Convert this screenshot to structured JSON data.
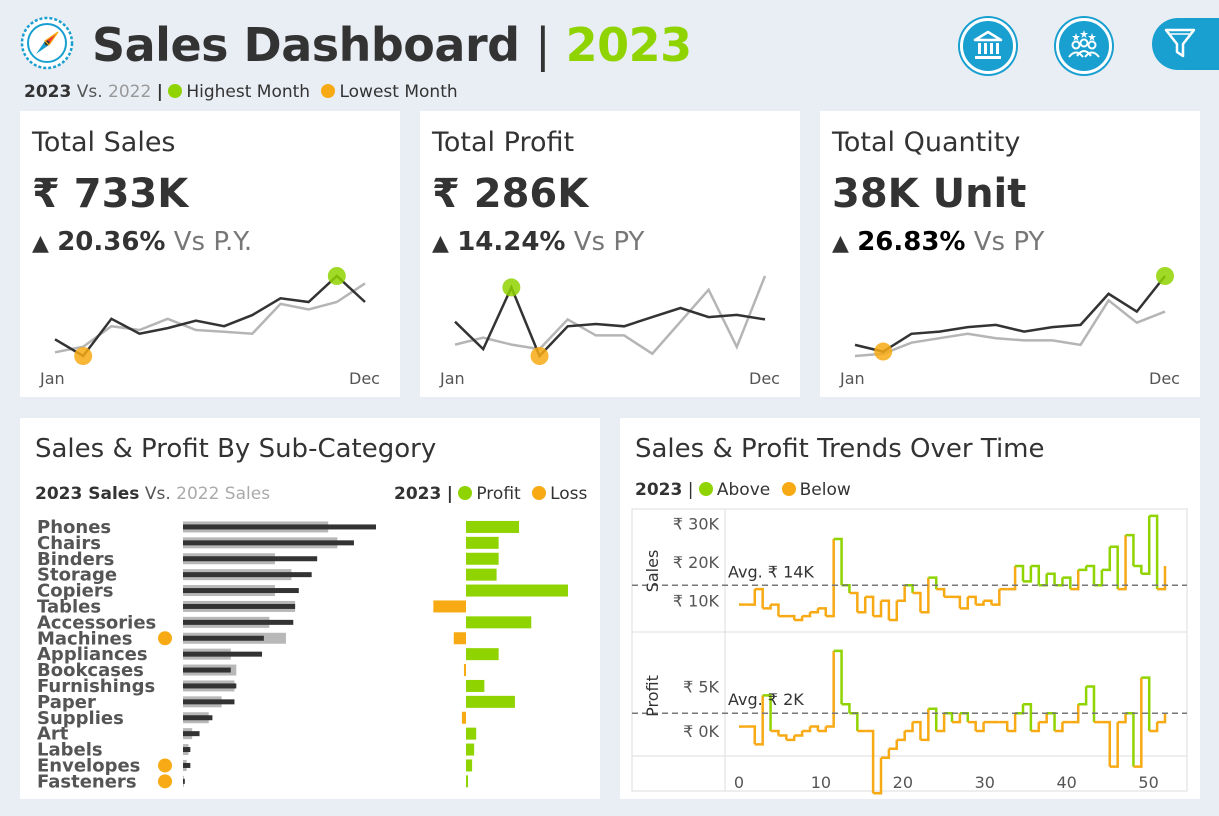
{
  "header": {
    "title": "Sales Dashboard",
    "separator": "|",
    "year": "2023",
    "legend": {
      "current": "2023",
      "vs": "Vs.",
      "previous": "2022",
      "sep": "|",
      "highest": "Highest Month",
      "lowest": "Lowest Month"
    },
    "icons": [
      "compass-logo",
      "bank-icon",
      "people-icon",
      "filter-icon"
    ]
  },
  "colors": {
    "accent_green": "#8fd400",
    "accent_orange": "#f7aa14",
    "current_line": "#333333",
    "previous_line": "#b5b5b5",
    "icon_blue": "#1aa0d0"
  },
  "kpis": [
    {
      "title": "Total Sales",
      "value": "₹ 733K",
      "arrow": "▲",
      "delta": "20.36%",
      "vs": "Vs P.Y.",
      "axis_start": "Jan",
      "axis_end": "Dec",
      "current": [
        30,
        21,
        41,
        33,
        36,
        40,
        37,
        43,
        52,
        50,
        64,
        50
      ],
      "previous": [
        23,
        26,
        37,
        35,
        41,
        35,
        34,
        33,
        49,
        46,
        50,
        60
      ],
      "highest_index": 10,
      "lowest_index": 1
    },
    {
      "title": "Total Profit",
      "value": "₹ 286K",
      "arrow": "▲",
      "delta": "14.24%",
      "vs": "Vs PY",
      "axis_start": "Jan",
      "axis_end": "Dec",
      "current": [
        22,
        10,
        37,
        7,
        20,
        21,
        20,
        24,
        28,
        24,
        25,
        23
      ],
      "previous": [
        12,
        15,
        12,
        10,
        23,
        16,
        16,
        8,
        22,
        36,
        11,
        42
      ],
      "highest_index": 2,
      "lowest_index": 3
    },
    {
      "title": "Total Quantity",
      "value": "38K Unit",
      "arrow": "▲",
      "delta": "26.83%",
      "vs": "Vs PY",
      "axis_start": "Jan",
      "axis_end": "Dec",
      "current": [
        30,
        27,
        35,
        36,
        38,
        39,
        36,
        38,
        39,
        53,
        45,
        61,
        58
      ],
      "previous": [
        25,
        26,
        31,
        33,
        35,
        33,
        32,
        32,
        30,
        50,
        40,
        45
      ],
      "highest_index": 11,
      "lowest_index": 1
    }
  ],
  "subcategory": {
    "title": "Sales & Profit By Sub-Category",
    "legend_left": {
      "current": "2023 Sales",
      "vs": "Vs.",
      "previous": "2022 Sales"
    },
    "legend_right": {
      "year": "2023",
      "sep": "|",
      "profit": "Profit",
      "loss": "Loss"
    },
    "chart_data": {
      "type": "bar",
      "categories": [
        "Phones",
        "Chairs",
        "Binders",
        "Storage",
        "Copiers",
        "Tables",
        "Accessories",
        "Machines",
        "Appliances",
        "Bookcases",
        "Furnishings",
        "Paper",
        "Supplies",
        "Art",
        "Labels",
        "Envelopes",
        "Fasteners"
      ],
      "sales_2023": [
        105,
        93,
        73,
        70,
        63,
        61,
        60,
        44,
        43,
        26,
        29,
        28,
        16,
        9,
        4,
        4,
        1
      ],
      "sales_2022": [
        79,
        84,
        50,
        59,
        50,
        61,
        47,
        56,
        26,
        29,
        28,
        21,
        14,
        5,
        3,
        2,
        0.5
      ],
      "profit": [
        26,
        16,
        16,
        15,
        50,
        -16,
        32,
        -6,
        16,
        -1,
        9,
        24,
        -2,
        5,
        4,
        3,
        1
      ],
      "lowest_markers": [
        "Machines",
        "Envelopes",
        "Fasteners"
      ]
    }
  },
  "trends": {
    "title": "Sales & Profit Trends Over Time",
    "legend": {
      "year": "2023",
      "sep": "|",
      "above": "Above",
      "below": "Below"
    },
    "sales_axis_label": "Sales",
    "profit_axis_label": "Profit",
    "sales_ticks": [
      "₹ 30K",
      "₹ 20K",
      "₹ 10K"
    ],
    "profit_ticks": [
      "₹ 5K",
      "₹ 0K"
    ],
    "sales_avg_label": "Avg. ₹ 14K",
    "profit_avg_label": "Avg. ₹ 2K",
    "x_ticks": [
      "0",
      "10",
      "20",
      "30",
      "40",
      "50"
    ],
    "chart_data": {
      "type": "line",
      "x_range": [
        0,
        52
      ],
      "sales_avg": 14000,
      "profit_avg": 2000,
      "sales": [
        9,
        9,
        13,
        8,
        9,
        6,
        6,
        5,
        6,
        7,
        8,
        6,
        26,
        14,
        12,
        7,
        11,
        6,
        10,
        5,
        10,
        14,
        12,
        7,
        16,
        13,
        11,
        11,
        8,
        11,
        9,
        10,
        9,
        13,
        13,
        19,
        15,
        19,
        14,
        17,
        14,
        16,
        13,
        18,
        19,
        14,
        18,
        24,
        13,
        27,
        19,
        17,
        32,
        13,
        19
      ],
      "profit": [
        0.5,
        0.5,
        -1.5,
        4,
        0,
        -0.5,
        -1,
        -0.5,
        0,
        0.5,
        0,
        0.5,
        9,
        3,
        2,
        0,
        0,
        -7,
        -3,
        -2,
        -1,
        0,
        1,
        -1,
        2.5,
        0,
        2,
        1,
        2,
        1,
        0,
        1,
        1,
        1,
        0,
        2,
        3,
        0,
        1,
        2,
        0,
        1,
        1,
        3,
        5,
        1,
        1,
        -4,
        1,
        2,
        -4,
        6,
        0,
        1,
        2
      ]
    }
  }
}
